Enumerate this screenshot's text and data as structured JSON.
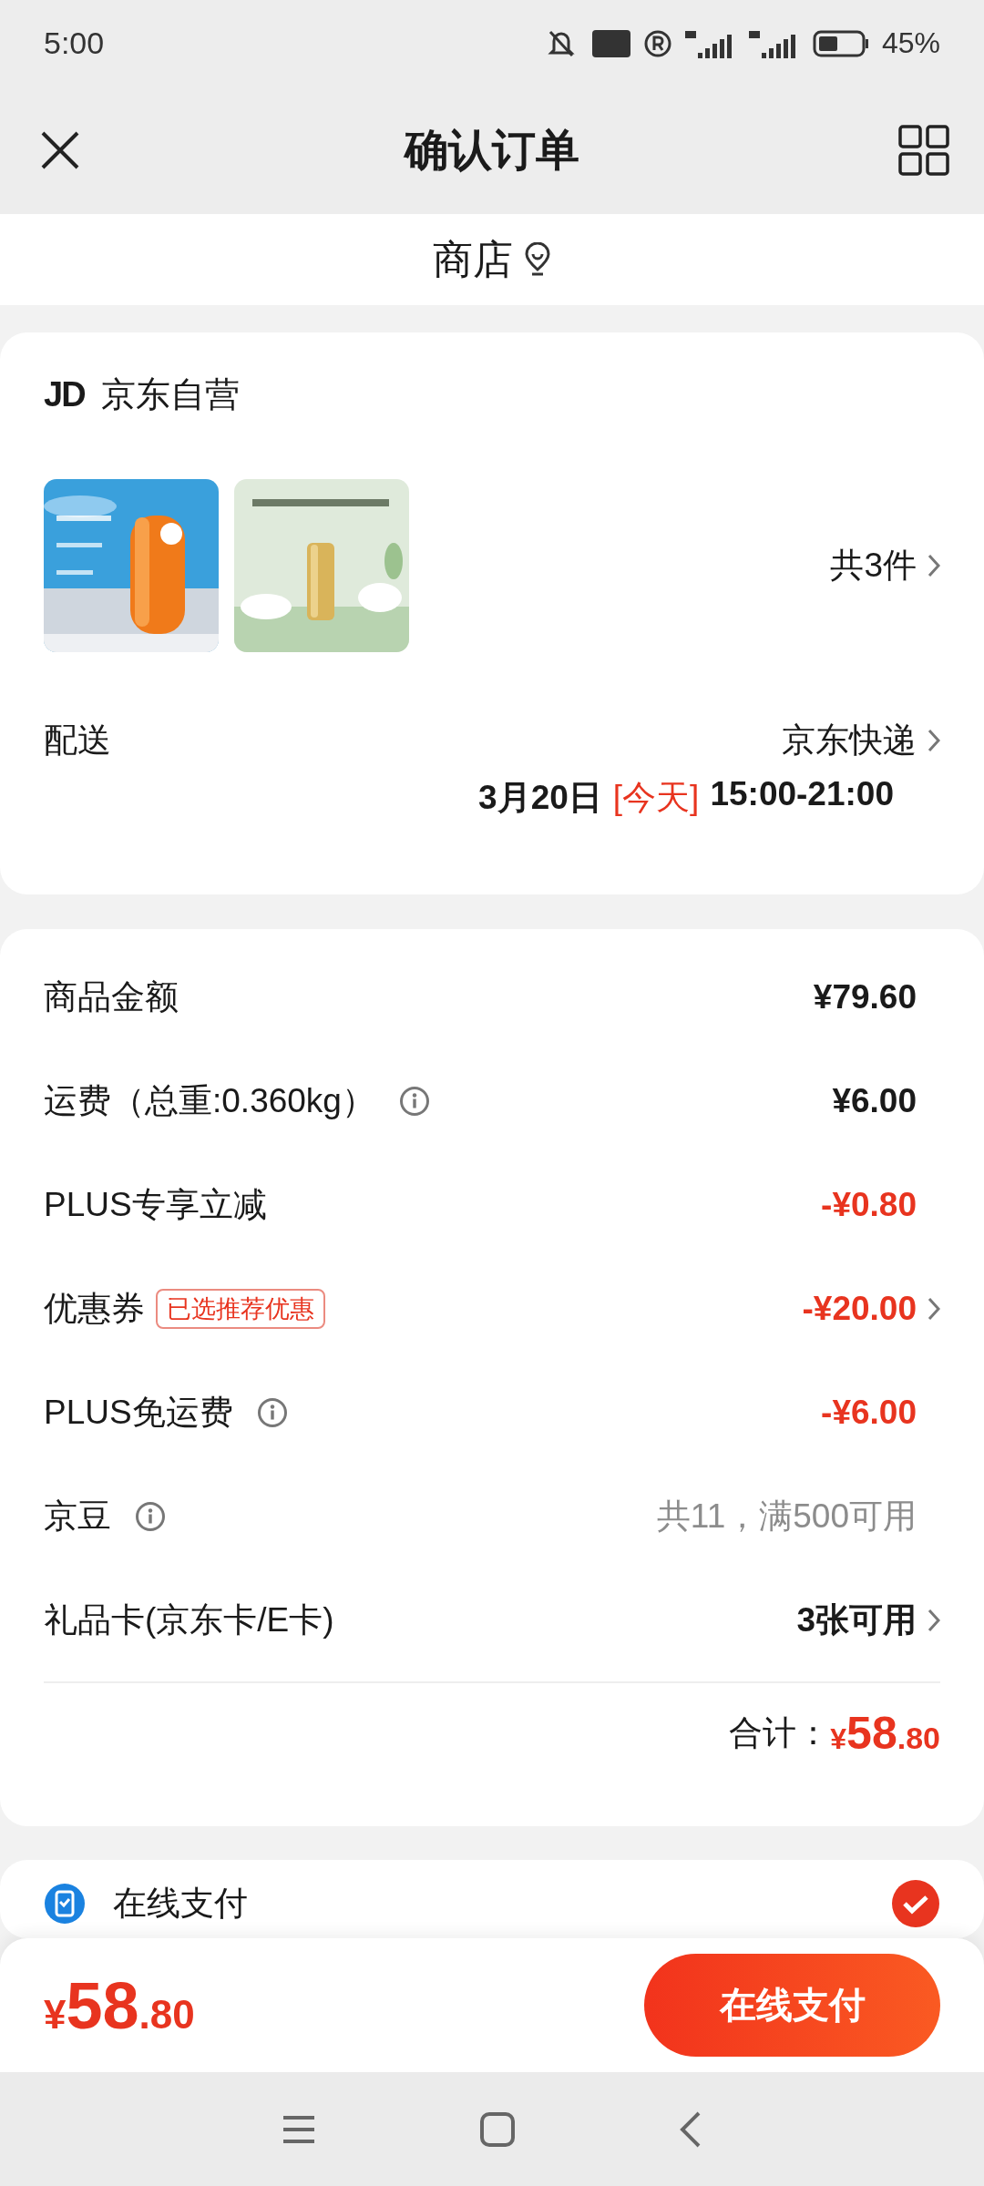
{
  "status_bar": {
    "time": "5:00",
    "battery": "45%"
  },
  "nav": {
    "title": "确认订单"
  },
  "store": {
    "label": "商店"
  },
  "shop": {
    "logo": "JD",
    "name": "京东自营"
  },
  "product_count": "共3件",
  "delivery": {
    "label": "配送",
    "method": "京东快递",
    "date": "3月20日",
    "day_tag": "[今天]",
    "window": "15:00-21:00"
  },
  "price_rows": [
    {
      "label": "商品金额",
      "info": false,
      "value": "¥79.60",
      "kind": "normal",
      "chevron": false
    },
    {
      "label": "运费（总重:0.360kg）",
      "info": true,
      "value": "¥6.00",
      "kind": "normal",
      "chevron": false
    },
    {
      "label": "PLUS专享立减",
      "info": false,
      "value": "-¥0.80",
      "kind": "discount",
      "chevron": false
    },
    {
      "label": "优惠券",
      "info": false,
      "tag": "已选推荐优惠",
      "value": "-¥20.00",
      "kind": "discount",
      "chevron": true
    },
    {
      "label": "PLUS免运费",
      "info": true,
      "value": "-¥6.00",
      "kind": "discount",
      "chevron": false
    },
    {
      "label": "京豆",
      "info": true,
      "value": "共11，满500可用",
      "kind": "muted",
      "chevron": false
    },
    {
      "label": "礼品卡(京东卡/E卡)",
      "info": false,
      "value": "3张可用",
      "kind": "normal",
      "chevron": true
    }
  ],
  "total": {
    "label": "合计：",
    "currency": "¥",
    "integer": "58",
    "decimals": ".80"
  },
  "payment": {
    "label": "在线支付",
    "selected": true
  },
  "footer": {
    "currency": "¥",
    "integer": "58",
    "decimals": ".80",
    "button": "在线支付"
  }
}
